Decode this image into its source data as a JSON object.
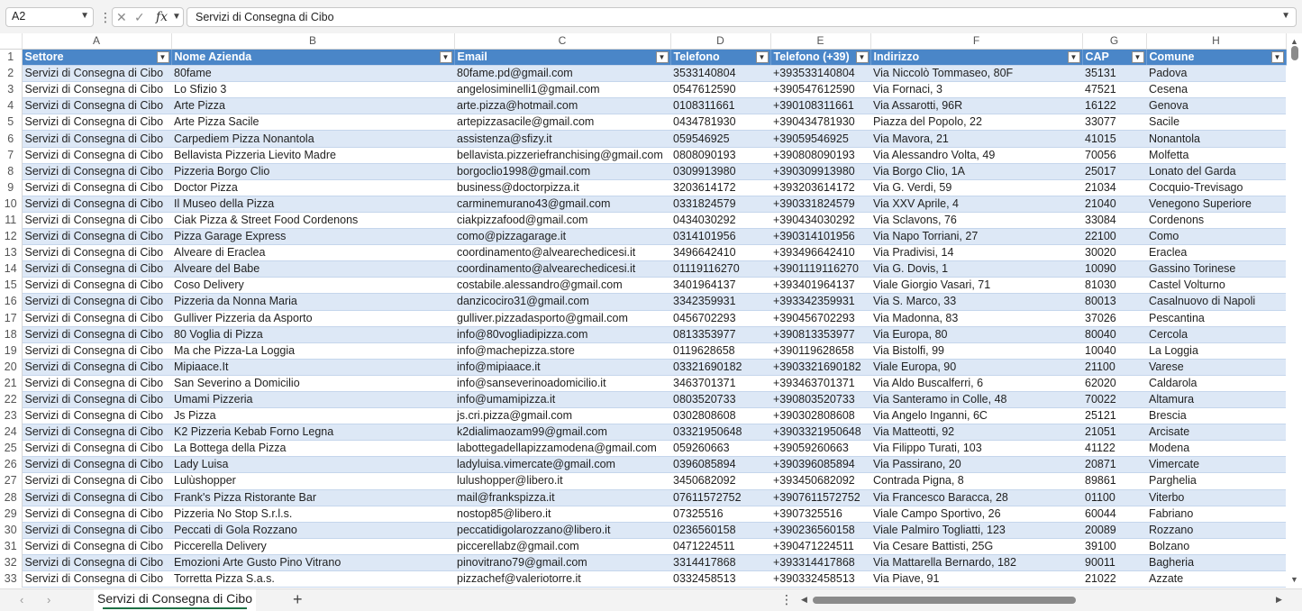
{
  "formula_bar": {
    "cell_ref": "A2",
    "formula": "Servizi di Consegna di Cibo",
    "fx_label": "fx"
  },
  "columns": [
    "A",
    "B",
    "C",
    "D",
    "E",
    "F",
    "G",
    "H"
  ],
  "headers": [
    "Settore",
    "Nome Azienda",
    "Email",
    "Telefono",
    "Telefono (+39)",
    "Indirizzo",
    "CAP",
    "Comune"
  ],
  "rows": [
    [
      "Servizi di Consegna di Cibo",
      "80fame",
      "80fame.pd@gmail.com",
      "3533140804",
      "+393533140804",
      "Via Niccolò Tommaseo, 80F",
      "35131",
      "Padova"
    ],
    [
      "Servizi di Consegna di Cibo",
      "Lo Sfizio 3",
      "angelosiminelli1@gmail.com",
      "0547612590",
      "+390547612590",
      "Via Fornaci, 3",
      "47521",
      "Cesena"
    ],
    [
      "Servizi di Consegna di Cibo",
      "Arte Pizza",
      "arte.pizza@hotmail.com",
      "0108311661",
      "+390108311661",
      "Via Assarotti, 96R",
      "16122",
      "Genova"
    ],
    [
      "Servizi di Consegna di Cibo",
      "Arte Pizza Sacile",
      "artepizzasacile@gmail.com",
      "0434781930",
      "+390434781930",
      "Piazza del Popolo, 22",
      "33077",
      "Sacile"
    ],
    [
      "Servizi di Consegna di Cibo",
      "Carpediem Pizza Nonantola",
      "assistenza@sfizy.it",
      "059546925",
      "+39059546925",
      "Via Mavora, 21",
      "41015",
      "Nonantola"
    ],
    [
      "Servizi di Consegna di Cibo",
      "Bellavista Pizzeria Lievito Madre",
      "bellavista.pizzeriefranchising@gmail.com",
      "0808090193",
      "+390808090193",
      "Via Alessandro Volta, 49",
      "70056",
      "Molfetta"
    ],
    [
      "Servizi di Consegna di Cibo",
      "Pizzeria Borgo Clio",
      "borgoclio1998@gmail.com",
      "0309913980",
      "+390309913980",
      "Via Borgo Clio, 1A",
      "25017",
      "Lonato del Garda"
    ],
    [
      "Servizi di Consegna di Cibo",
      "Doctor Pizza",
      "business@doctorpizza.it",
      "3203614172",
      "+393203614172",
      "Via G. Verdi, 59",
      "21034",
      "Cocquio-Trevisago"
    ],
    [
      "Servizi di Consegna di Cibo",
      "Il Museo della Pizza",
      "carminemurano43@gmail.com",
      "0331824579",
      "+390331824579",
      "Via XXV Aprile, 4",
      "21040",
      "Venegono Superiore"
    ],
    [
      "Servizi di Consegna di Cibo",
      "Ciak Pizza & Street Food Cordenons",
      "ciakpizzafood@gmail.com",
      "0434030292",
      "+390434030292",
      "Via Sclavons, 76",
      "33084",
      "Cordenons"
    ],
    [
      "Servizi di Consegna di Cibo",
      "Pizza Garage Express",
      "como@pizzagarage.it",
      "0314101956",
      "+390314101956",
      "Via Napo Torriani, 27",
      "22100",
      "Como"
    ],
    [
      "Servizi di Consegna di Cibo",
      "Alveare di Eraclea",
      "coordinamento@alvearechedicesi.it",
      "3496642410",
      "+393496642410",
      "Via Pradivisi, 14",
      "30020",
      "Eraclea"
    ],
    [
      "Servizi di Consegna di Cibo",
      "Alveare del Babe",
      "coordinamento@alvearechedicesi.it",
      "01119116270",
      "+3901119116270",
      "Via G. Dovis, 1",
      "10090",
      "Gassino Torinese"
    ],
    [
      "Servizi di Consegna di Cibo",
      "Coso Delivery",
      "costabile.alessandro@gmail.com",
      "3401964137",
      "+393401964137",
      "Viale Giorgio Vasari, 71",
      "81030",
      "Castel Volturno"
    ],
    [
      "Servizi di Consegna di Cibo",
      "Pizzeria da Nonna Maria",
      "danzicociro31@gmail.com",
      "3342359931",
      "+393342359931",
      "Via S. Marco, 33",
      "80013",
      "Casalnuovo di Napoli"
    ],
    [
      "Servizi di Consegna di Cibo",
      "Gulliver Pizzeria da Asporto",
      "gulliver.pizzadasporto@gmail.com",
      "0456702293",
      "+390456702293",
      "Via Madonna, 83",
      "37026",
      "Pescantina"
    ],
    [
      "Servizi di Consegna di Cibo",
      "80 Voglia di Pizza",
      "info@80vogliadipizza.com",
      "0813353977",
      "+390813353977",
      "Via Europa, 80",
      "80040",
      "Cercola"
    ],
    [
      "Servizi di Consegna di Cibo",
      "Ma che Pizza-La Loggia",
      "info@machepizza.store",
      "0119628658",
      "+390119628658",
      "Via Bistolfi, 99",
      "10040",
      "La Loggia"
    ],
    [
      "Servizi di Consegna di Cibo",
      "Mipiaace.It",
      "info@mipiaace.it",
      "03321690182",
      "+3903321690182",
      "Viale Europa, 90",
      "21100",
      "Varese"
    ],
    [
      "Servizi di Consegna di Cibo",
      "San Severino a Domicilio",
      "info@sanseverinoadomicilio.it",
      "3463701371",
      "+393463701371",
      "Via Aldo Buscalferri, 6",
      "62020",
      "Caldarola"
    ],
    [
      "Servizi di Consegna di Cibo",
      "Umami Pizzeria",
      "info@umamipizza.it",
      "0803520733",
      "+390803520733",
      "Via Santeramo in Colle, 48",
      "70022",
      "Altamura"
    ],
    [
      "Servizi di Consegna di Cibo",
      "Js Pizza",
      "js.cri.pizza@gmail.com",
      "0302808608",
      "+390302808608",
      "Via Angelo Inganni, 6C",
      "25121",
      "Brescia"
    ],
    [
      "Servizi di Consegna di Cibo",
      "K2 Pizzeria Kebab Forno Legna",
      "k2dialimaozam99@gmail.com",
      "03321950648",
      "+3903321950648",
      "Via Matteotti, 92",
      "21051",
      "Arcisate"
    ],
    [
      "Servizi di Consegna di Cibo",
      "La Bottega della Pizza",
      "labottegadellapizzamodena@gmail.com",
      "059260663",
      "+39059260663",
      "Via Filippo Turati, 103",
      "41122",
      "Modena"
    ],
    [
      "Servizi di Consegna di Cibo",
      "Lady Luisa",
      "ladyluisa.vimercate@gmail.com",
      "0396085894",
      "+390396085894",
      "Via Passirano, 20",
      "20871",
      "Vimercate"
    ],
    [
      "Servizi di Consegna di Cibo",
      "Lulùshopper",
      "lulushopper@libero.it",
      "3450682092",
      "+393450682092",
      "Contrada Pigna, 8",
      "89861",
      "Parghelia"
    ],
    [
      "Servizi di Consegna di Cibo",
      "Frank's Pizza Ristorante Bar",
      "mail@frankspizza.it",
      "07611572752",
      "+3907611572752",
      "Via Francesco Baracca, 28",
      "01100",
      "Viterbo"
    ],
    [
      "Servizi di Consegna di Cibo",
      "Pizzeria No Stop S.r.l.s.",
      "nostop85@libero.it",
      "07325516",
      "+3907325516",
      "Viale Campo Sportivo, 26",
      "60044",
      "Fabriano"
    ],
    [
      "Servizi di Consegna di Cibo",
      "Peccati di Gola Rozzano",
      "peccatidigolarozzano@libero.it",
      "0236560158",
      "+390236560158",
      "Viale Palmiro Togliatti, 123",
      "20089",
      "Rozzano"
    ],
    [
      "Servizi di Consegna di Cibo",
      "Piccerella Delivery",
      "piccerellabz@gmail.com",
      "0471224511",
      "+390471224511",
      "Via Cesare Battisti, 25G",
      "39100",
      "Bolzano"
    ],
    [
      "Servizi di Consegna di Cibo",
      "Emozioni Arte Gusto Pino Vitrano",
      "pinovitrano79@gmail.com",
      "3314417868",
      "+393314417868",
      "Via Mattarella Bernardo, 182",
      "90011",
      "Bagheria"
    ],
    [
      "Servizi di Consegna di Cibo",
      "Torretta Pizza S.a.s.",
      "pizzachef@valeriotorre.it",
      "0332458513",
      "+390332458513",
      "Via Piave, 91",
      "21022",
      "Azzate"
    ]
  ],
  "sheet_tab": "Servizi di Consegna di Cibo",
  "colors": {
    "header_fill": "#4a86c8",
    "band_fill": "#dde8f6",
    "tab_accent": "#1e7145"
  },
  "icons": [
    "chevron-down-icon",
    "cancel-icon",
    "enter-icon",
    "fx-icon",
    "add-sheet-icon",
    "more-icon"
  ]
}
